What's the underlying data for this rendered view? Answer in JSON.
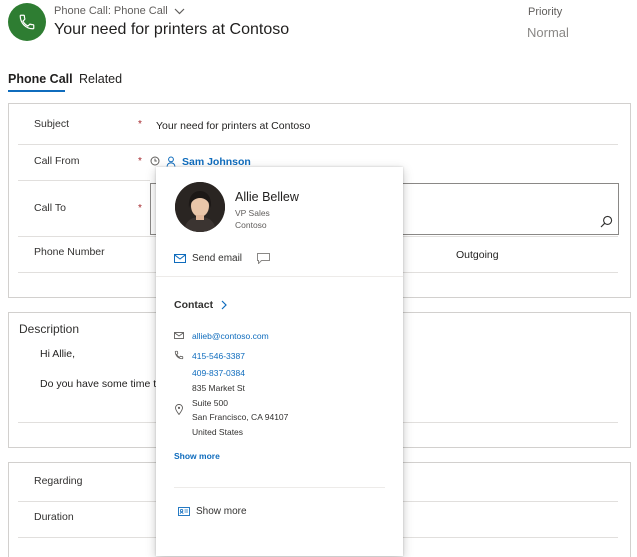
{
  "header": {
    "entity_type": "Phone Call: Phone Call",
    "title": "Your need for printers at Contoso",
    "priority_label": "Priority",
    "priority_value": "Normal"
  },
  "tabs": [
    {
      "label": "Phone Call",
      "active": true
    },
    {
      "label": "Related",
      "active": false
    }
  ],
  "summary": {
    "subject_label": "Subject",
    "subject_value": "Your need for printers at Contoso",
    "call_from_label": "Call From",
    "call_from_value": "Sam Johnson",
    "call_to_label": "Call To",
    "phone_label": "Phone Number",
    "direction_value": "Outgoing",
    "required_mark": "*"
  },
  "description": {
    "label": "Description",
    "line1": "Hi Allie,",
    "line2": "Do you have some time to"
  },
  "details": {
    "regarding_label": "Regarding",
    "duration_label": "Duration"
  },
  "contact_card": {
    "name": "Allie Bellew",
    "job_title": "VP Sales",
    "company": "Contoso",
    "send_email_label": "Send email",
    "contact_heading": "Contact",
    "email": "allieb@contoso.com",
    "phone1": "415-546-3387",
    "phone2": "409-837-0384",
    "address_line1": "835 Market St",
    "address_line2": "Suite 500",
    "address_line3": "San Francisco, CA 94107",
    "address_line4": "United States",
    "show_more_link": "Show more",
    "show_more_footer": "Show more"
  },
  "colors": {
    "brand_green": "#2e7d32",
    "accent_blue": "#0f6cbd",
    "required_red": "#a4262c"
  }
}
